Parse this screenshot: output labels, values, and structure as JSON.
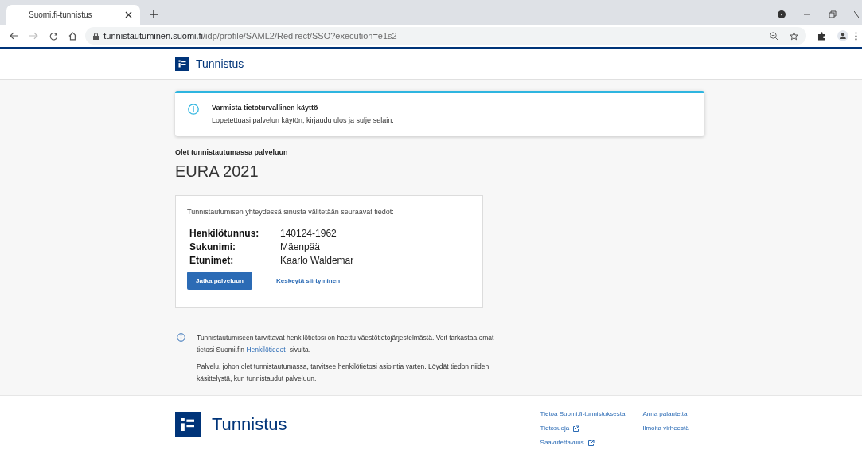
{
  "browser": {
    "tab_title": "Suomi.fi-tunnistus",
    "url_host": "tunnistautuminen.suomi.fi",
    "url_path": "/idp/profile/SAML2/Redirect/SSO?execution=e1s2"
  },
  "header": {
    "logo_text": "Tunnistus"
  },
  "notice": {
    "title": "Varmista tietoturvallinen käyttö",
    "text": "Lopetettuasi palvelun käytön, kirjaudu ulos ja sulje selain."
  },
  "service": {
    "intro": "Olet tunnistautumassa palveluun",
    "name": "EURA 2021"
  },
  "consent": {
    "intro": "Tunnistautumisen yhteydessä sinusta välitetään seuraavat tiedot:",
    "fields": [
      {
        "label": "Henkilötunnus:",
        "value": "140124-1962"
      },
      {
        "label": "Sukunimi:",
        "value": "Mäenpää"
      },
      {
        "label": "Etunimet:",
        "value": "Kaarlo Waldemar"
      }
    ],
    "primary_button": "Jatka palveluun",
    "cancel_link": "Keskeytä siirtyminen"
  },
  "info": {
    "text_before": "Tunnistautumiseen tarvittavat henkilötietosi on haettu väestötietojärjestelmästä. Voit tarkastaa omat tietosi Suomi.fin",
    "link": "Henkilötiedot",
    "text_after": "-sivulta.",
    "second": "Palvelu, johon olet tunnistautumassa, tarvitsee henkilötietosi asiointia varten. Löydät tiedon niiden käsittelystä, kun tunnistaudut palveluun."
  },
  "footer": {
    "logo_text": "Tunnistus",
    "columns": [
      [
        {
          "label": "Tietoa Suomi.fi-tunnistuksesta",
          "external": false
        },
        {
          "label": "Tietosuoja",
          "external": true
        },
        {
          "label": "Saavutettavuus",
          "external": true
        }
      ],
      [
        {
          "label": "Anna palautetta",
          "external": false
        },
        {
          "label": "Ilmoita virheestä",
          "external": false
        }
      ]
    ]
  }
}
